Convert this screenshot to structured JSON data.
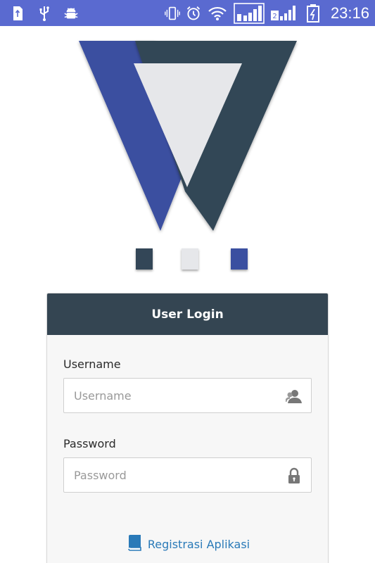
{
  "status_bar": {
    "time": "23:16",
    "left_icons": [
      "sd-card-icon",
      "usb-icon",
      "android-debug-icon"
    ],
    "right_icons": [
      "vibrate-icon",
      "alarm-icon",
      "wifi-icon",
      "signal-sim1-icon",
      "signal-sim2-icon",
      "battery-charging-icon"
    ],
    "sim2_label": "2"
  },
  "colors": {
    "status_bar": "#5a6ad0",
    "logo_blue": "#3a4fa0",
    "logo_dark": "#334657",
    "logo_light": "#e6e7ea",
    "card_header": "#344552",
    "link": "#2a7ab8"
  },
  "login": {
    "title": "User Login",
    "username_label": "Username",
    "username_placeholder": "Username",
    "password_label": "Password",
    "password_placeholder": "Password",
    "register_link": "Registrasi Aplikasi"
  }
}
